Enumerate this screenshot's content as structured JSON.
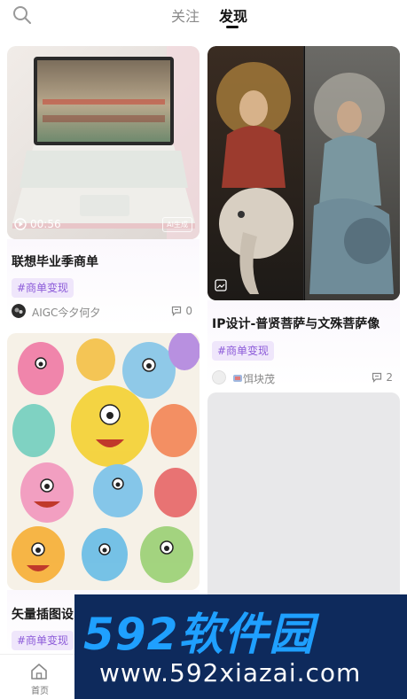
{
  "header": {
    "tabs": [
      {
        "label": "关注",
        "active": false
      },
      {
        "label": "发现",
        "active": true
      }
    ]
  },
  "feed": {
    "left": [
      {
        "title": "联想毕业季商单",
        "tag": "#商单变现",
        "author": "AIGC今夕何夕",
        "comments": "0",
        "video_duration": "00:56",
        "ai_badge": "AI生成"
      },
      {
        "title": "矢量插图设",
        "tag": "#商单变现"
      }
    ],
    "right": [
      {
        "title": "IP设计-普贤菩萨与文殊菩萨像",
        "tag": "#商单变现",
        "author": "饵块茂",
        "comments": "2"
      }
    ]
  },
  "bottom_nav": {
    "home_label": "首页"
  },
  "watermark": {
    "brand": "592软件园",
    "url": "www.592xiazai.com"
  },
  "colors": {
    "tag_bg": "#efe6fb",
    "tag_text": "#8c5bd9",
    "watermark_bg": "#0e2a5c",
    "watermark_accent": "#1fa0ff"
  }
}
